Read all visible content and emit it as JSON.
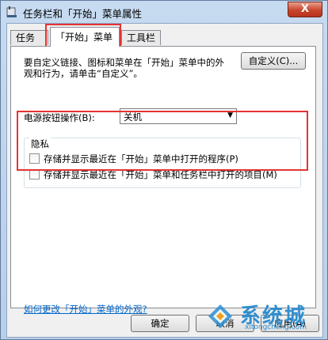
{
  "window": {
    "title": "任务栏和「开始」菜单属性",
    "close_label": "X"
  },
  "tabs": [
    {
      "label": "任务栏"
    },
    {
      "label": "「开始」菜单"
    },
    {
      "label": "工具栏"
    }
  ],
  "panel": {
    "description": "要自定义链接、图标和菜单在「开始」菜单中的外观和行为，请单击“自定义”。",
    "customize_label": "自定义(C)...",
    "power_label": "电源按钮操作(B):",
    "power_value": "关机",
    "privacy": {
      "title": "隐私",
      "options": [
        {
          "label": "存储并显示最近在「开始」菜单中打开的程序(P)",
          "checked": false
        },
        {
          "label": "存储并显示最近在「开始」菜单和任务栏中打开的项目(M)",
          "checked": false
        }
      ]
    },
    "link_text": "如何更改「开始」菜单的外观?"
  },
  "buttons": {
    "ok": "确定",
    "cancel": "取消",
    "apply": "应用(A)"
  },
  "watermark": {
    "text": "系统城",
    "sub": "xitongcheng.com"
  },
  "colors": {
    "highlight": "#e53232",
    "link": "#0066cc",
    "close": "#c9452d"
  }
}
